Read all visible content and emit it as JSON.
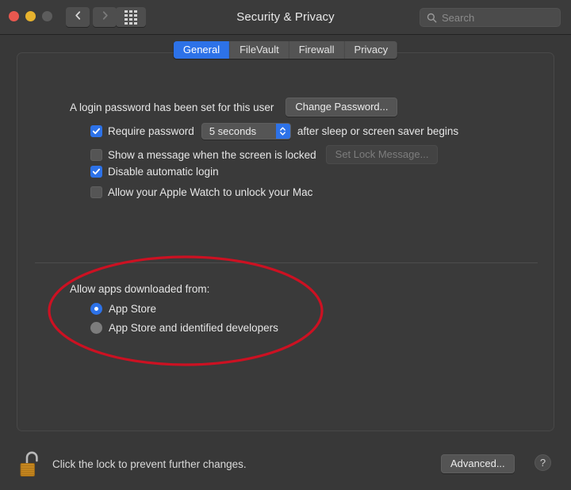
{
  "window": {
    "title": "Security & Privacy",
    "traffic_lights": [
      {
        "name": "close",
        "color": "#e8584f"
      },
      {
        "name": "minimize",
        "color": "#e6b22e"
      },
      {
        "name": "zoom",
        "color": "#5c5c5c"
      }
    ],
    "nav": {
      "back_icon": "chevron-left-icon",
      "forward_icon": "chevron-right-icon",
      "grid_icon": "show-all-grid-icon"
    },
    "search": {
      "placeholder": "Search",
      "value": "",
      "icon": "search-icon"
    }
  },
  "tabs": [
    {
      "label": "General",
      "active": true
    },
    {
      "label": "FileVault",
      "active": false
    },
    {
      "label": "Firewall",
      "active": false
    },
    {
      "label": "Privacy",
      "active": false
    }
  ],
  "general": {
    "password_status": "A login password has been set for this user",
    "change_password_button": "Change Password...",
    "require_password": {
      "checked": true,
      "label_before": "Require password",
      "delay_value": "5 seconds",
      "label_after": "after sleep or screen saver begins"
    },
    "show_message": {
      "checked": false,
      "label": "Show a message when the screen is locked",
      "button": "Set Lock Message...",
      "button_disabled": true
    },
    "disable_auto_login": {
      "checked": true,
      "label": "Disable automatic login"
    },
    "apple_watch": {
      "checked": false,
      "label": "Allow your Apple Watch to unlock your Mac"
    },
    "allow_apps_label": "Allow apps downloaded from:",
    "allow_apps_options": [
      {
        "label": "App Store",
        "selected": true
      },
      {
        "label": "App Store and identified developers",
        "selected": false
      }
    ]
  },
  "annotation": {
    "shape": "ellipse",
    "color": "#cc1122",
    "target": "allow-apps-downloaded-from-section"
  },
  "footer": {
    "lock_icon": "unlocked-padlock-icon",
    "lock_text": "Click the lock to prevent further changes.",
    "advanced_button": "Advanced...",
    "help_button": "?"
  },
  "colors": {
    "accent": "#2d72e8",
    "window_bg": "#383838",
    "panel_bg": "#3a3a3a",
    "annotation_red": "#cc1122",
    "lock_body": "#c8881f"
  }
}
